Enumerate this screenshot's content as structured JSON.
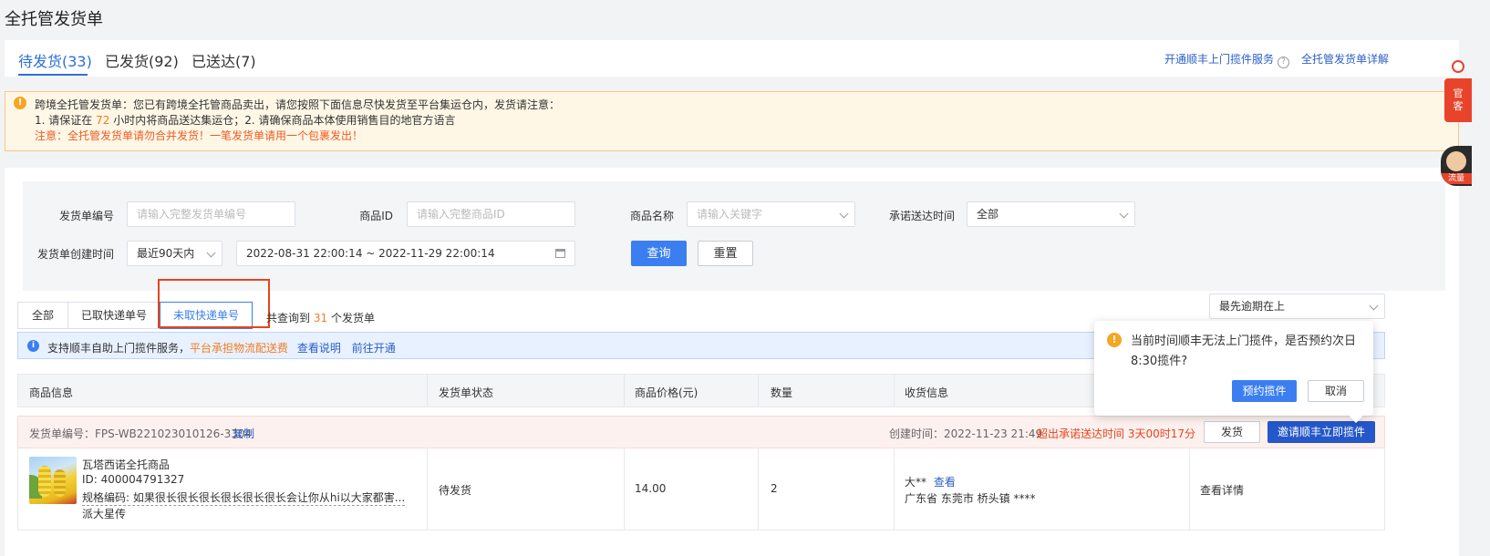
{
  "page_title": "全托管发货单",
  "tabs": [
    {
      "label": "待发货(33)",
      "active": true
    },
    {
      "label": "已发货(92)",
      "active": false
    },
    {
      "label": "已送达(7)",
      "active": false
    }
  ],
  "top_links": {
    "sf_service": "开通顺丰上门揽件服务",
    "help": "?",
    "detail": "全托管发货单详解"
  },
  "notice": {
    "line1": "跨境全托管发货单：您已有跨境全托管商品卖出，请您按照下面信息尽快发货至平台集运仓内，发货请注意：",
    "line2_a": "1. 请保证在",
    "line2_hours": "72",
    "line2_b": "小时内将商品送达集运仓；2. 请确保商品本体使用销售目的地官方语言",
    "line3": "注意：全托管发货单请勿合并发货！一笔发货单请用一个包裹发出！",
    "icon": "!"
  },
  "filters": {
    "order_no_label": "发货单编号",
    "order_no_placeholder": "请输入完整发货单编号",
    "product_id_label": "商品ID",
    "product_id_placeholder": "请输入完整商品ID",
    "product_name_label": "商品名称",
    "product_name_placeholder": "请输入关键字",
    "promise_time_label": "承诺送达时间",
    "promise_time_value": "全部",
    "create_time_label": "发货单创建时间",
    "create_time_range": "最近90天内",
    "date_range": "2022-08-31 22:00:14 ~ 2022-11-29 22:00:14",
    "query_button": "查询",
    "reset_button": "重置"
  },
  "segments": [
    {
      "label": "全部",
      "active": false
    },
    {
      "label": "已取快递单号",
      "active": false
    },
    {
      "label": "未取快递单号",
      "active": true
    }
  ],
  "result_count": {
    "prefix": "共查询到",
    "count": "31",
    "suffix": "个发货单"
  },
  "sort_value": "最先逾期在上",
  "info_bar": {
    "icon": "i",
    "text": "支持顺丰自助上门揽件服务，",
    "highlight": "平台承担物流配送费",
    "link1": "查看说明",
    "link2": "前往开通"
  },
  "table_headers": [
    "商品信息",
    "发货单状态",
    "商品价格(元)",
    "数量",
    "收货信息"
  ],
  "order": {
    "order_no": "发货单编号：FPS-WB221023010126-3304",
    "copy": "复制",
    "created": "创建时间：2022-11-23 21:49",
    "overdue": "超出承诺送达时间 3天00时17分",
    "ship_button": "发货",
    "invite_button": "邀请顺丰立即揽件",
    "product_name": "瓦塔西诺全托商品",
    "product_id": "ID: 400004791327",
    "spec": "规格编码: 如果很长很长很长很长很长很长会让你从hi以大家都害...",
    "shop": "派大星传",
    "status": "待发货",
    "price": "14.00",
    "quantity": "2",
    "receiver_name": "大**",
    "receiver_view": "查看",
    "receiver_address": "广东省 东莞市 桥头镇 ****",
    "view_detail": "查看详情"
  },
  "popover": {
    "icon": "!",
    "text": "当前时间顺丰无法上门揽件，是否预约次日8:30揽件?",
    "confirm": "预约揽件",
    "cancel": "取消"
  },
  "side": {
    "red_label": "官\n客",
    "avatar_tag": "流量"
  }
}
